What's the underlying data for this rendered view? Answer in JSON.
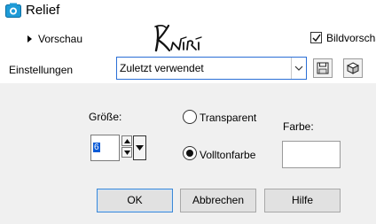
{
  "window": {
    "title": "Relief",
    "icon": "photo-app-icon"
  },
  "header": {
    "preview_toggle_label": "Vorschau",
    "logo_text": "Kniri",
    "preview_checkbox_label": "Bildvorschau",
    "preview_checkbox_checked": true
  },
  "settings": {
    "label": "Einstellungen",
    "preset_value": "Zuletzt verwendet",
    "save_icon": "save-icon",
    "random_icon": "dice-icon"
  },
  "controls": {
    "size_label": "Größe:",
    "size_value": "6",
    "transparent_label": "Transparent",
    "solid_color_label": "Volltonfarbe",
    "selected_fill": "Volltonfarbe",
    "color_label": "Farbe:",
    "color_value": "#ffffff"
  },
  "buttons": {
    "ok": "OK",
    "cancel": "Abbrechen",
    "help": "Hilfe"
  },
  "colors": {
    "focus_blue": "#2b6fd6",
    "selection_blue": "#0a5bd6",
    "dialog_bg": "#f0f0f0"
  }
}
